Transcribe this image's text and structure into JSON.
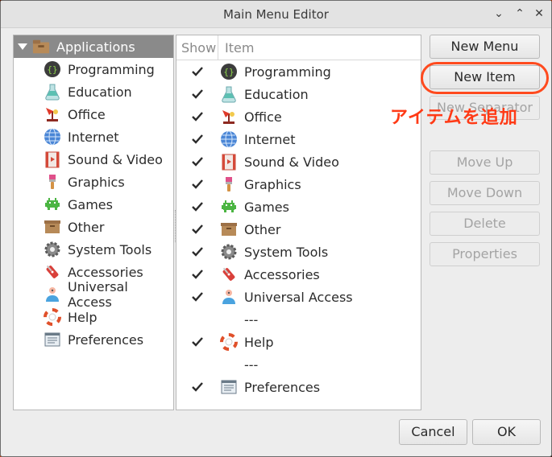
{
  "window": {
    "title": "Main Menu Editor",
    "controls": {
      "minimize": "⌄",
      "maximize": "⌃",
      "close": "✕"
    }
  },
  "tree": {
    "root_label": "Applications",
    "items": [
      {
        "label": "Programming",
        "icon": "programming-icon"
      },
      {
        "label": "Education",
        "icon": "education-icon"
      },
      {
        "label": "Office",
        "icon": "office-icon"
      },
      {
        "label": "Internet",
        "icon": "internet-icon"
      },
      {
        "label": "Sound & Video",
        "icon": "sound-video-icon"
      },
      {
        "label": "Graphics",
        "icon": "graphics-icon"
      },
      {
        "label": "Games",
        "icon": "games-icon"
      },
      {
        "label": "Other",
        "icon": "other-icon"
      },
      {
        "label": "System Tools",
        "icon": "system-tools-icon"
      },
      {
        "label": "Accessories",
        "icon": "accessories-icon"
      },
      {
        "label": "Universal Access",
        "icon": "universal-access-icon"
      },
      {
        "label": "Help",
        "icon": "help-icon"
      },
      {
        "label": "Preferences",
        "icon": "preferences-icon"
      }
    ]
  },
  "list": {
    "header_show": "Show",
    "header_item": "Item",
    "separator_text": "---",
    "rows": [
      {
        "label": "Programming",
        "checked": true
      },
      {
        "label": "Education",
        "checked": true
      },
      {
        "label": "Office",
        "checked": true
      },
      {
        "label": "Internet",
        "checked": true
      },
      {
        "label": "Sound & Video",
        "checked": true
      },
      {
        "label": "Graphics",
        "checked": true
      },
      {
        "label": "Games",
        "checked": true
      },
      {
        "label": "Other",
        "checked": true
      },
      {
        "label": "System Tools",
        "checked": true
      },
      {
        "label": "Accessories",
        "checked": true
      },
      {
        "label": "Universal Access",
        "checked": true
      },
      {
        "label": "---",
        "separator": true
      },
      {
        "label": "Help",
        "checked": true
      },
      {
        "label": "---",
        "separator": true
      },
      {
        "label": "Preferences",
        "checked": true
      }
    ]
  },
  "buttons": {
    "new_menu": "New Menu",
    "new_item": "New Item",
    "new_separator": "New Separator",
    "move_up": "Move Up",
    "move_down": "Move Down",
    "delete": "Delete",
    "properties": "Properties",
    "cancel": "Cancel",
    "ok": "OK"
  },
  "annotation": {
    "text": "アイテムを追加",
    "color": "#ff3a16"
  },
  "colors": {
    "accent_ring": "#ff4a1e",
    "tree_selected": "#8a8a8a"
  }
}
